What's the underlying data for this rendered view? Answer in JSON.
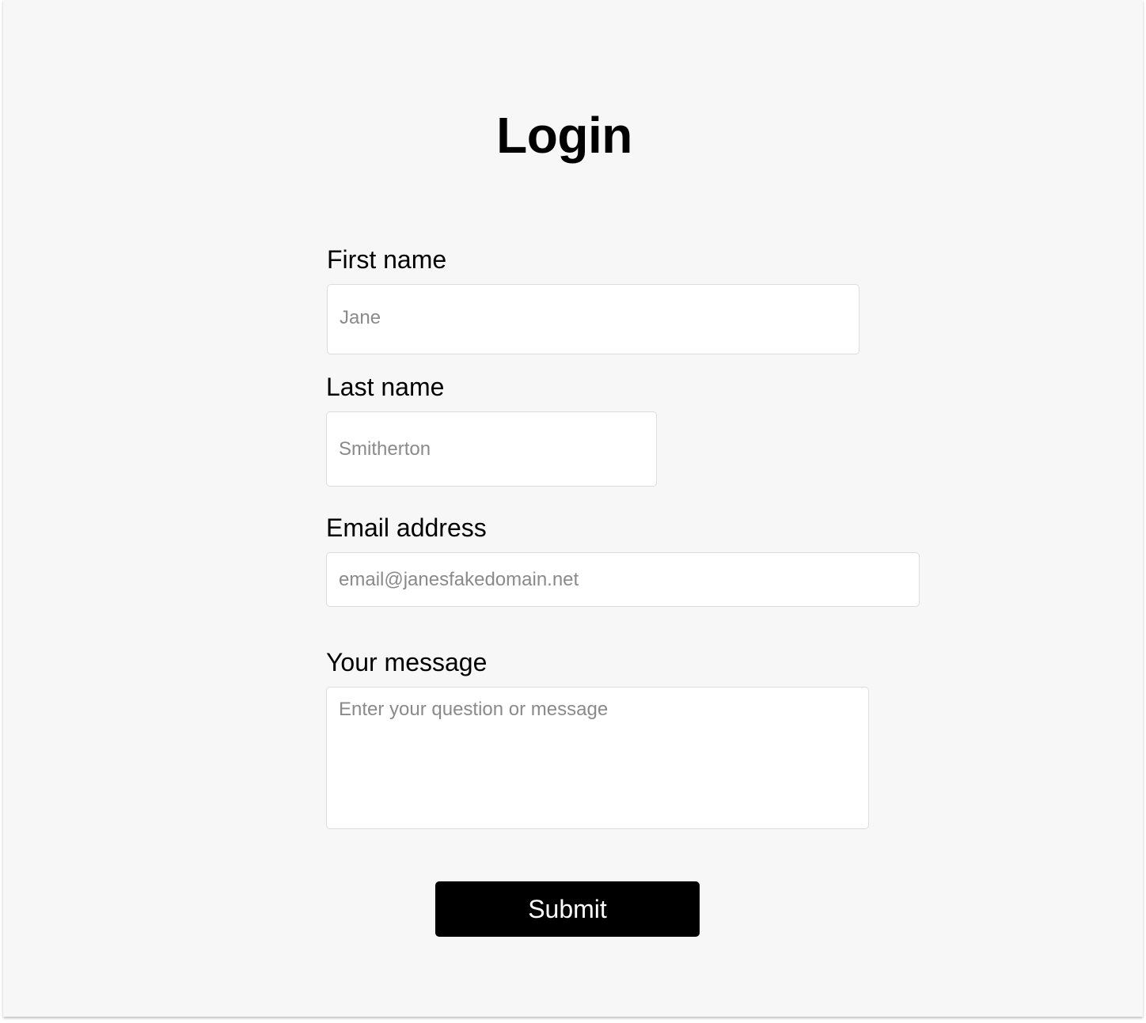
{
  "form": {
    "title": "Login",
    "first_name": {
      "label": "First name",
      "placeholder": "Jane"
    },
    "last_name": {
      "label": "Last name",
      "placeholder": "Smitherton"
    },
    "email": {
      "label": "Email address",
      "placeholder": "email@janesfakedomain.net"
    },
    "message": {
      "label": "Your message",
      "placeholder": "Enter your question or message"
    },
    "submit_label": "Submit"
  },
  "colors": {
    "background": "#f7f7f7",
    "button": "#000000",
    "button_text": "#ffffff",
    "placeholder": "#8a8a8a"
  }
}
